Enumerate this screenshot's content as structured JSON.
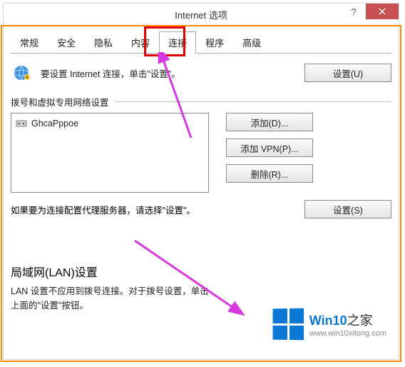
{
  "window": {
    "title": "Internet 选项"
  },
  "tabs": [
    "常规",
    "安全",
    "隐私",
    "内容",
    "连接",
    "程序",
    "高级"
  ],
  "active_tab_index": 4,
  "setup": {
    "text": "要设置 Internet 连接，单击\"设置\"。",
    "button": "设置(U)"
  },
  "dial": {
    "group_label": "拨号和虚拟专用网络设置",
    "items": [
      "GhcaPppoe"
    ],
    "add_btn": "添加(D)...",
    "add_vpn_btn": "添加 VPN(P)...",
    "remove_btn": "删除(R)...",
    "proxy_text": "如果要为连接配置代理服务器，请选择\"设置\"。",
    "settings_btn": "设置(S)"
  },
  "lan": {
    "group_label": "局域网(LAN)设置",
    "text": "LAN 设置不应用到拨号连接。对于拨号设置，单击上面的\"设置\"按钮。"
  },
  "watermark": {
    "brand_a": "Win10",
    "brand_b": "之家",
    "url": "www.win10xitong.com"
  }
}
